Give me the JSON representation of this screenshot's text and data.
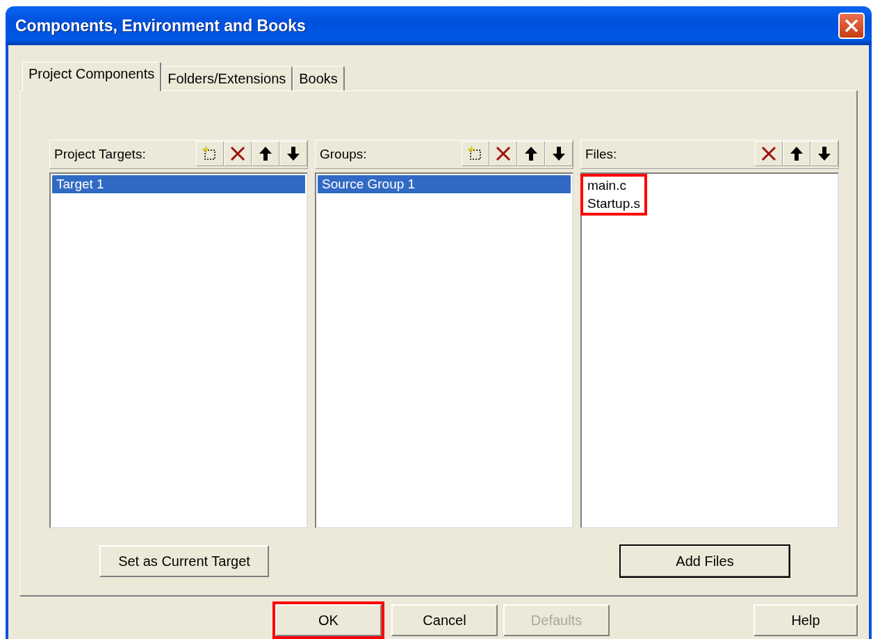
{
  "window": {
    "title": "Components, Environment and Books"
  },
  "tabs": [
    {
      "label": "Project Components",
      "selected": true
    },
    {
      "label": "Folders/Extensions",
      "selected": false
    },
    {
      "label": "Books",
      "selected": false
    }
  ],
  "panes": [
    {
      "label": "Project Targets:",
      "tools": [
        {
          "kind": "new"
        },
        {
          "kind": "delete"
        },
        {
          "kind": "up"
        },
        {
          "kind": "down"
        }
      ],
      "items": [
        {
          "text": "Target 1",
          "selected": true
        }
      ],
      "highlighted": false
    },
    {
      "label": "Groups:",
      "tools": [
        {
          "kind": "new"
        },
        {
          "kind": "delete"
        },
        {
          "kind": "up"
        },
        {
          "kind": "down"
        }
      ],
      "items": [
        {
          "text": "Source Group 1",
          "selected": true
        }
      ],
      "highlighted": false
    },
    {
      "label": "Files:",
      "tools": [
        {
          "kind": "delete"
        },
        {
          "kind": "up"
        },
        {
          "kind": "down"
        }
      ],
      "items": [
        {
          "text": "main.c",
          "selected": false
        },
        {
          "text": "Startup.s",
          "selected": false
        }
      ],
      "highlighted": true
    }
  ],
  "pane_buttons": [
    {
      "label": "Set as Current Target",
      "default": false
    },
    {
      "label": "Add Files",
      "default": true
    }
  ],
  "buttons": [
    {
      "label": "OK",
      "disabled": false,
      "highlighted": true
    },
    {
      "label": "Cancel",
      "disabled": false,
      "highlighted": false
    },
    {
      "label": "Defaults",
      "disabled": true,
      "highlighted": false
    },
    {
      "label": "Help",
      "disabled": false,
      "highlighted": false
    }
  ]
}
